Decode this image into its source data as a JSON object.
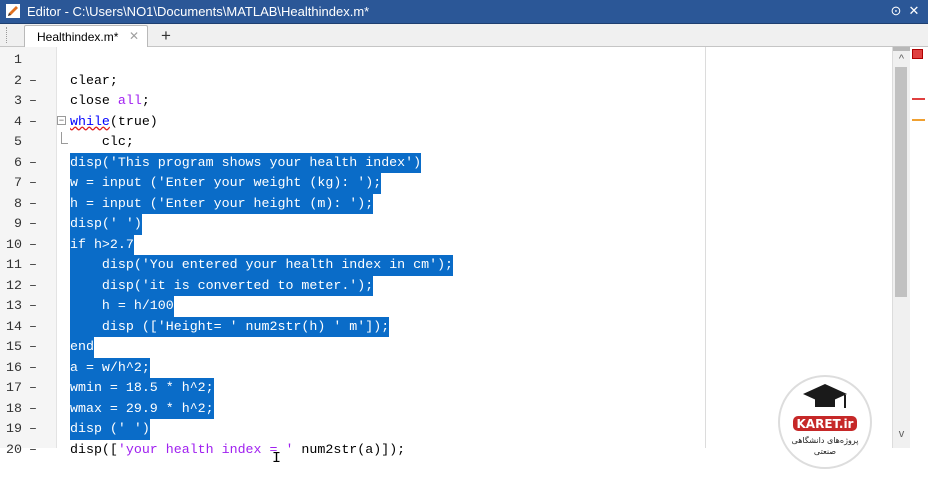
{
  "window": {
    "title": "Editor - C:\\Users\\NO1\\Documents\\MATLAB\\Healthindex.m*",
    "menu_glyph": "⊙",
    "close_glyph": "✕"
  },
  "tabs": [
    {
      "label": "Healthindex.m*",
      "close_glyph": "✕"
    }
  ],
  "add_tab_glyph": "+",
  "gutter": {
    "lines": [
      {
        "n": "1",
        "dash": ""
      },
      {
        "n": "2",
        "dash": "–"
      },
      {
        "n": "3",
        "dash": "–"
      },
      {
        "n": "4",
        "dash": "–"
      },
      {
        "n": "5",
        "dash": ""
      },
      {
        "n": "6",
        "dash": "–"
      },
      {
        "n": "7",
        "dash": "–"
      },
      {
        "n": "8",
        "dash": "–"
      },
      {
        "n": "9",
        "dash": "–"
      },
      {
        "n": "10",
        "dash": "–"
      },
      {
        "n": "11",
        "dash": "–"
      },
      {
        "n": "12",
        "dash": "–"
      },
      {
        "n": "13",
        "dash": "–"
      },
      {
        "n": "14",
        "dash": "–"
      },
      {
        "n": "15",
        "dash": "–"
      },
      {
        "n": "16",
        "dash": "–"
      },
      {
        "n": "17",
        "dash": "–"
      },
      {
        "n": "18",
        "dash": "–"
      },
      {
        "n": "19",
        "dash": "–"
      },
      {
        "n": "20",
        "dash": "–"
      }
    ]
  },
  "code": {
    "line2": "clear;",
    "line3_a": "close ",
    "line3_b": "all",
    "line3_c": ";",
    "line4_kw": "while",
    "line4_rest": "(true)",
    "line5": "    clc;",
    "line6_a": "disp(",
    "line6_b": "'This program shows your health index'",
    "line6_c": ")",
    "line7_a": "w = input (",
    "line7_b": "'Enter your weight (kg): '",
    "line7_c": ");",
    "line8_a": "h = input (",
    "line8_b": "'Enter your height (m): '",
    "line8_c": ");",
    "line9_a": "disp(",
    "line9_b": "' '",
    "line9_c": ")",
    "line10_kw": "if",
    "line10_rest": " h>2.7",
    "line11_a": "    disp(",
    "line11_b": "'You entered your health index in cm'",
    "line11_c": ");",
    "line12_a": "    disp(",
    "line12_b": "'it is converted to meter.'",
    "line12_c": ");",
    "line13": "    h = h/100",
    "line14_a": "    disp ([",
    "line14_b": "'Height= '",
    "line14_c": " num2str(h) ",
    "line14_d": "' m'",
    "line14_e": "]);",
    "line15_kw": "end",
    "line16": "a = w/h^2;",
    "line17": "wmin = 18.5 * h^2;",
    "line18": "wmax = 29.9 * h^2;",
    "line19_a": "disp (",
    "line19_b": "' '",
    "line19_c": ")",
    "line20_a": "disp([",
    "line20_b": "'your health index = '",
    "line20_c": " num2str(a)]);"
  },
  "scrollbar": {
    "up_glyph": "^",
    "down_glyph": "v"
  },
  "logo": {
    "brand": "KARET.ir",
    "tagline_1": "پروژه‌های دانشگاهی",
    "tagline_2": "صنعتی"
  },
  "colors": {
    "selection": "#0a6cc8",
    "keyword": "#0000ff",
    "string": "#a020f0",
    "titlebar": "#2b5797"
  }
}
